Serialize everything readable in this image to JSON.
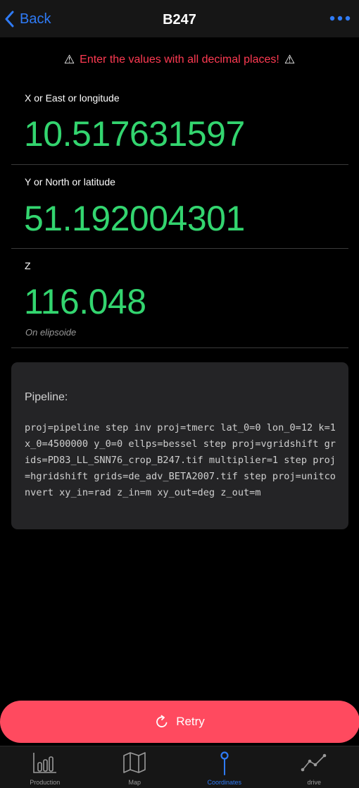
{
  "header": {
    "back_label": "Back",
    "title": "B247",
    "more_icon": "ellipsis-icon"
  },
  "warning": {
    "icon": "⚠",
    "text": "Enter the values with all decimal places!"
  },
  "fields": [
    {
      "label": "X or East or longitude",
      "value": "10.517631597"
    },
    {
      "label": "Y or North or latitude",
      "value": "51.192004301"
    },
    {
      "label": "Z",
      "value": "116.048",
      "hint": "On elipsoide"
    }
  ],
  "pipeline": {
    "title": "Pipeline:",
    "text": "proj=pipeline step inv proj=tmerc lat_0=0 lon_0=12 k=1 x_0=4500000 y_0=0 ellps=bessel step proj=vgridshift grids=PD83_LL_SNN76_crop_B247.tif multiplier=1 step proj=hgridshift grids=de_adv_BETA2007.tif step proj=unitconvert xy_in=rad z_in=m xy_out=deg z_out=m"
  },
  "retry": {
    "label": "Retry",
    "icon": "refresh-icon"
  },
  "tabs": [
    {
      "label": "Production",
      "icon": "bar-chart-icon",
      "active": false
    },
    {
      "label": "Map",
      "icon": "map-icon",
      "active": false
    },
    {
      "label": "Coordinates",
      "icon": "location-pin-icon",
      "active": true
    },
    {
      "label": "drive",
      "icon": "trend-line-icon",
      "active": false
    }
  ],
  "colors": {
    "accent_blue": "#2f7bf6",
    "value_green": "#33d56f",
    "warning_red": "#ff3a52",
    "retry_red": "#ff4a5f",
    "background": "#000000",
    "panel": "#242426"
  }
}
